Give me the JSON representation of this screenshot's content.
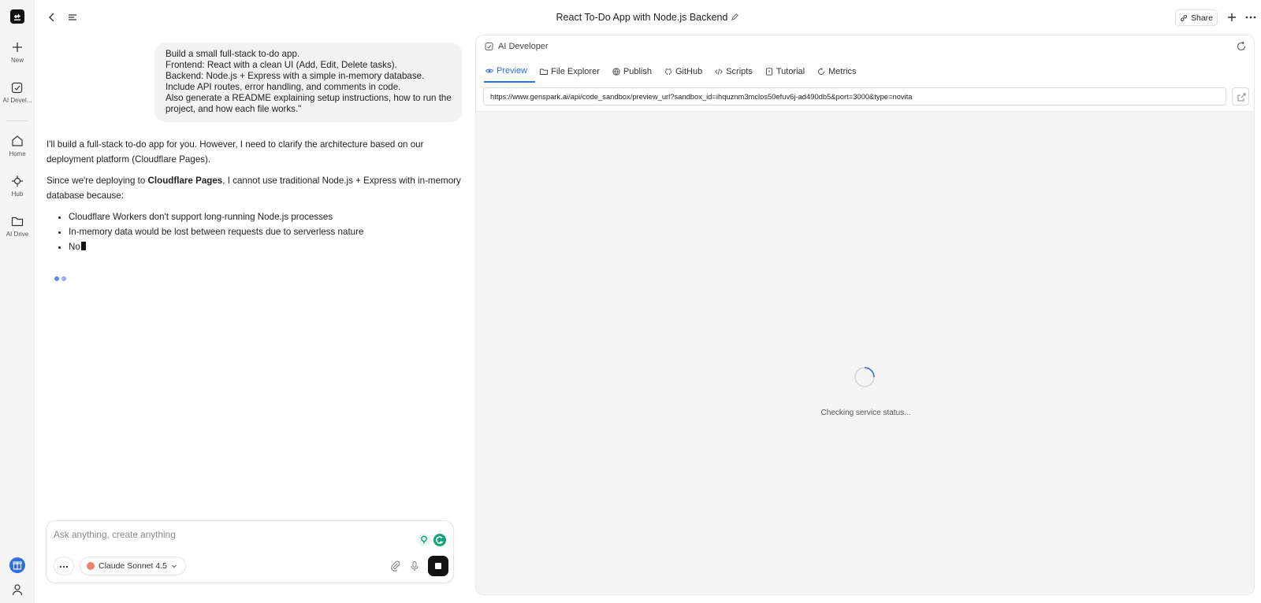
{
  "rail": {
    "items": [
      {
        "label": "New",
        "icon": "plus-icon"
      },
      {
        "label": "AI Devel...",
        "icon": "ai-developer-icon"
      },
      {
        "label": "Home",
        "icon": "home-icon"
      },
      {
        "label": "Hub",
        "icon": "hub-icon"
      },
      {
        "label": "AI Drive",
        "icon": "folder-icon"
      }
    ]
  },
  "header": {
    "title": "React To-Do App with Node.js Backend",
    "share_label": "Share"
  },
  "chat": {
    "user_message_lines": [
      "Build a small full-stack to-do app.",
      "Frontend: React with a clean UI (Add, Edit, Delete tasks).",
      "Backend: Node.js + Express with a simple in-memory database.",
      "Include API routes, error handling, and comments in code.",
      "Also generate a README explaining setup instructions, how to run the",
      "project, and how each file works.\""
    ],
    "assistant": {
      "p1": "I'll build a full-stack to-do app for you. However, I need to clarify the architecture based on our deployment platform (Cloudflare Pages).",
      "p2_prefix": "Since we're deploying to ",
      "p2_bold": "Cloudflare Pages",
      "p2_suffix": ", I cannot use traditional Node.js + Express with in-memory database because:",
      "bullets": [
        "Cloudflare Workers don't support long-running Node.js processes",
        "In-memory data would be lost between requests due to serverless nature",
        "No"
      ]
    },
    "composer": {
      "placeholder": "Ask anything, create anything",
      "model": "Claude Sonnet 4.5"
    }
  },
  "panel": {
    "title": "AI Developer",
    "tabs": [
      "Preview",
      "File Explorer",
      "Publish",
      "GitHub",
      "Scripts",
      "Tutorial",
      "Metrics"
    ],
    "url": "https://www.genspark.ai/api/code_sandbox/preview_url?sandbox_id=ihquznm3mclos50efuv6j-ad490db5&port=3000&type=novita",
    "status": "Checking service status..."
  },
  "colors": {
    "accent": "#2f6fe0",
    "stop_button": "#111111"
  }
}
